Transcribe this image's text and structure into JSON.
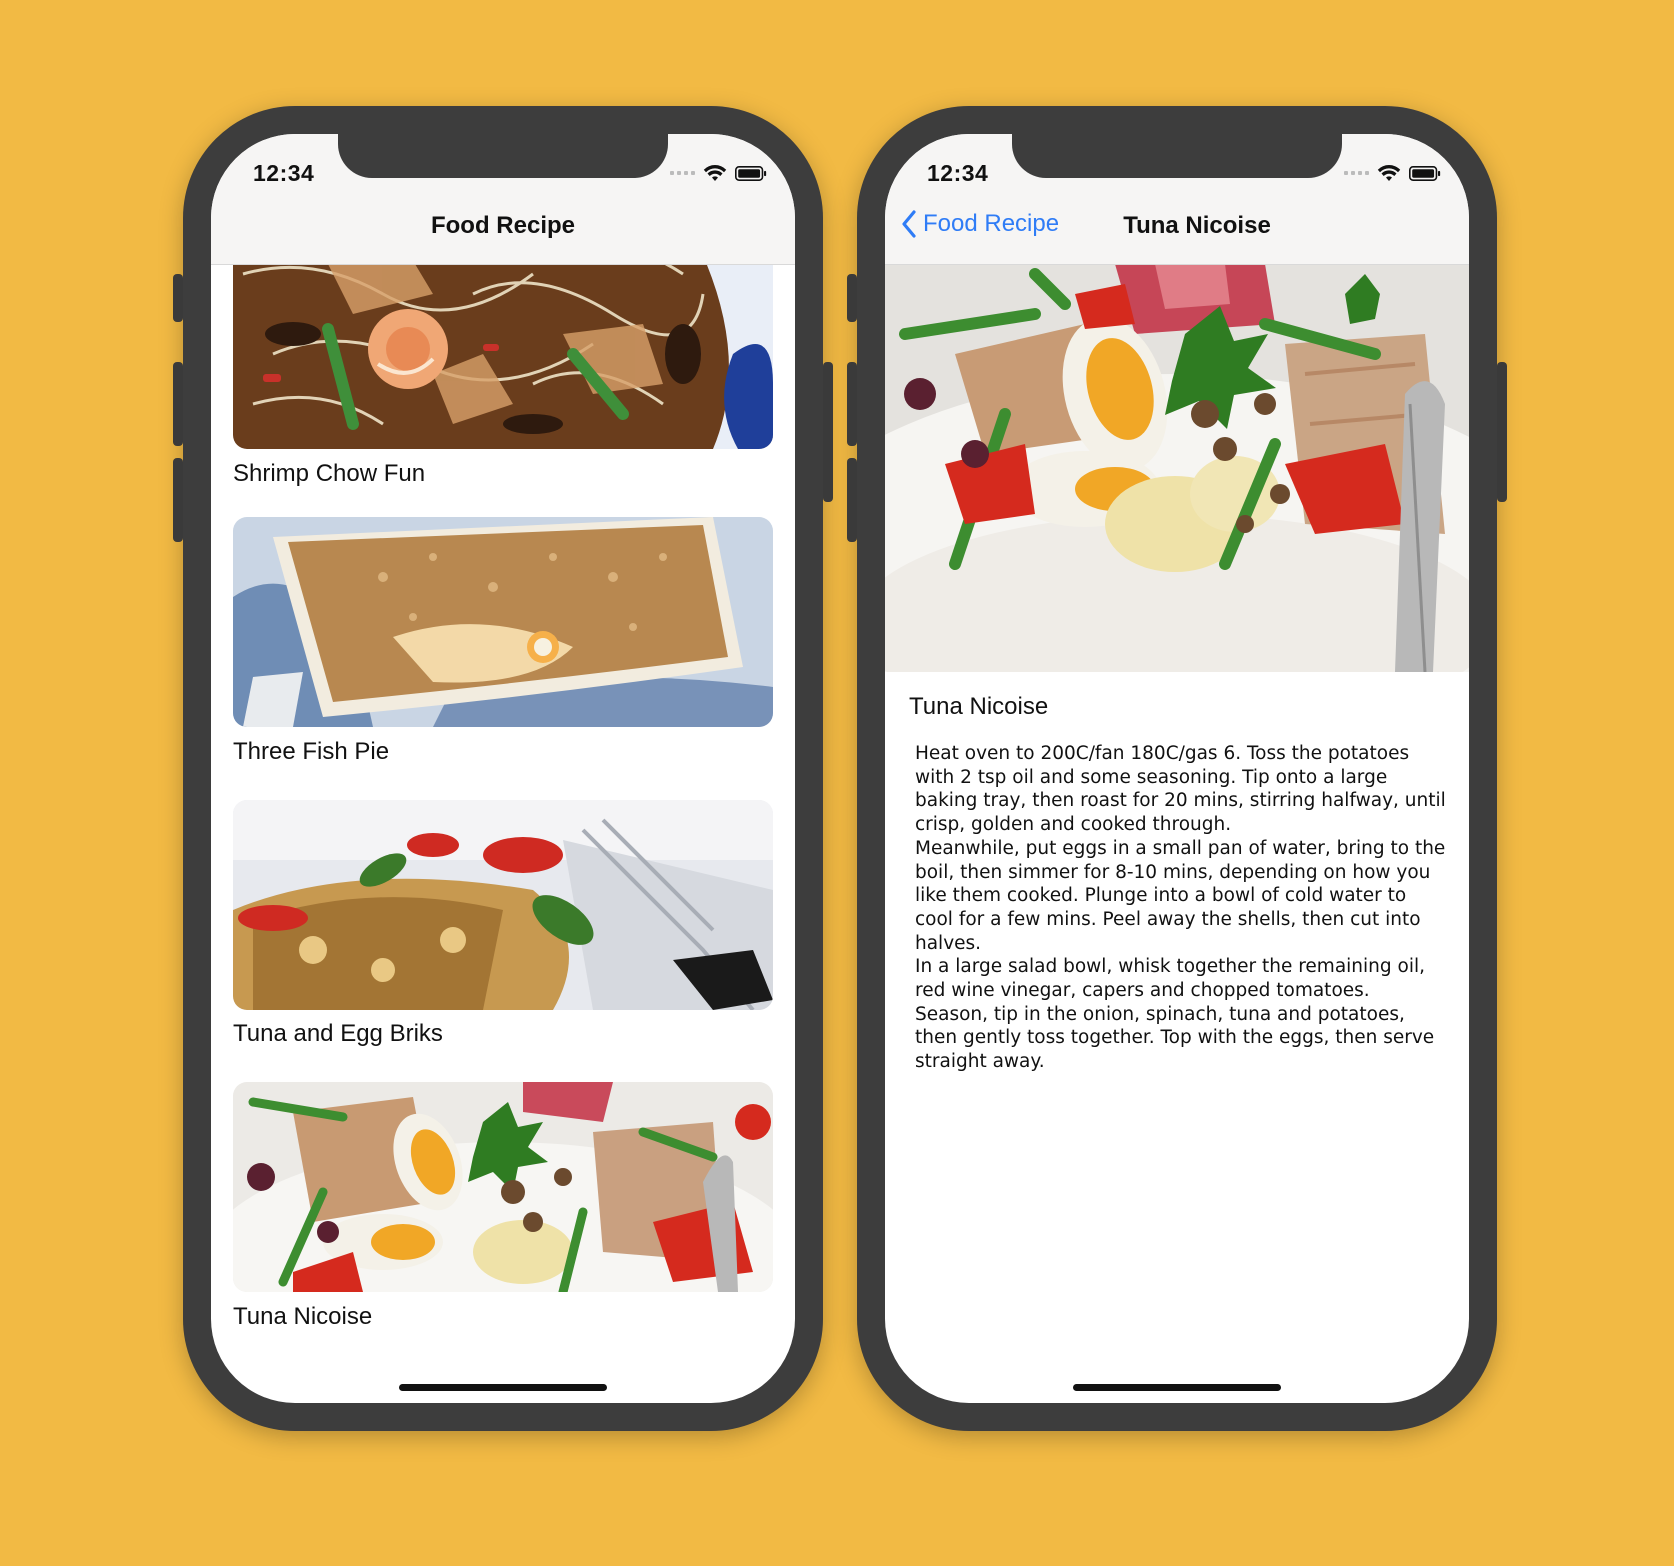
{
  "left_phone": {
    "status": {
      "time": "12:34"
    },
    "nav": {
      "title": "Food Recipe"
    },
    "recipes": [
      {
        "name": "Shrimp Chow Fun",
        "image": "shrimp-noodles-image"
      },
      {
        "name": "Three Fish Pie",
        "image": "fish-pie-image"
      },
      {
        "name": "Tuna and Egg Briks",
        "image": "tuna-briks-image"
      },
      {
        "name": "Tuna Nicoise",
        "image": "tuna-nicoise-image"
      }
    ]
  },
  "right_phone": {
    "status": {
      "time": "12:34"
    },
    "nav": {
      "back_label": "Food Recipe",
      "title": "Tuna Nicoise"
    },
    "detail": {
      "title": "Tuna Nicoise",
      "image": "tuna-nicoise-image",
      "body": "Heat oven to 200C/fan 180C/gas 6. Toss the potatoes with 2 tsp oil and some seasoning. Tip onto a large baking tray, then roast for 20 mins, stirring halfway, until crisp, golden and cooked through.\nMeanwhile, put eggs in a small pan of water, bring to the boil, then simmer for 8-10 mins, depending on how you like them cooked. Plunge into a bowl of cold water to cool for a few mins. Peel away the shells, then cut into halves.\nIn a large salad bowl, whisk together the remaining oil, red wine vinegar, capers and chopped tomatoes. Season, tip in the onion, spinach, tuna and potatoes, then gently toss together. Top with the eggs, then serve straight away."
    }
  },
  "colors": {
    "background": "#F2BA44",
    "frame": "#3d3d3d",
    "link": "#2f7cf6"
  }
}
